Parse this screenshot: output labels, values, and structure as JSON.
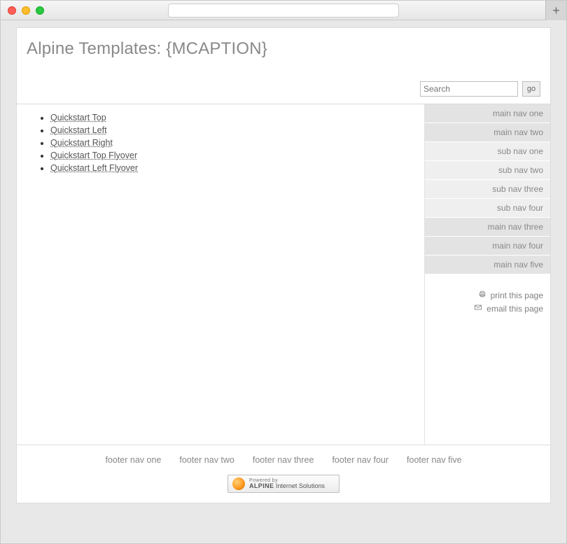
{
  "header": {
    "title": "Alpine Templates: {MCAPTION}"
  },
  "search": {
    "placeholder": "Search",
    "button": "go"
  },
  "main": {
    "links": [
      "Quickstart Top",
      "Quickstart Left",
      "Quickstart Right",
      "Quickstart Top Flyover",
      "Quickstart Left Flyover"
    ]
  },
  "sidenav": [
    {
      "label": "main nav one",
      "type": "main"
    },
    {
      "label": "main nav two",
      "type": "main"
    },
    {
      "label": "sub nav one",
      "type": "sub"
    },
    {
      "label": "sub nav two",
      "type": "sub"
    },
    {
      "label": "sub nav three",
      "type": "sub"
    },
    {
      "label": "sub nav four",
      "type": "sub"
    },
    {
      "label": "main nav three",
      "type": "main"
    },
    {
      "label": "main nav four",
      "type": "main"
    },
    {
      "label": "main nav five",
      "type": "main"
    }
  ],
  "tools": {
    "print": "print this page",
    "email": "email this page"
  },
  "footer": {
    "links": [
      "footer nav one",
      "footer nav two",
      "footer nav three",
      "footer nav four",
      "footer nav five"
    ],
    "badge": {
      "line1": "Powered by",
      "brand": "ALPINE",
      "rest": " Internet Solutions"
    }
  }
}
